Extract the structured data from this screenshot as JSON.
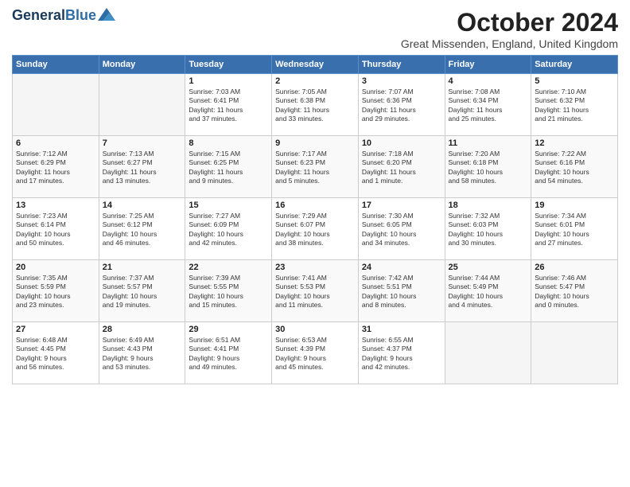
{
  "logo": {
    "line1": "General",
    "line2": "Blue"
  },
  "header": {
    "title": "October 2024",
    "location": "Great Missenden, England, United Kingdom"
  },
  "weekdays": [
    "Sunday",
    "Monday",
    "Tuesday",
    "Wednesday",
    "Thursday",
    "Friday",
    "Saturday"
  ],
  "weeks": [
    [
      {
        "day": "",
        "data": ""
      },
      {
        "day": "",
        "data": ""
      },
      {
        "day": "1",
        "data": "Sunrise: 7:03 AM\nSunset: 6:41 PM\nDaylight: 11 hours\nand 37 minutes."
      },
      {
        "day": "2",
        "data": "Sunrise: 7:05 AM\nSunset: 6:38 PM\nDaylight: 11 hours\nand 33 minutes."
      },
      {
        "day": "3",
        "data": "Sunrise: 7:07 AM\nSunset: 6:36 PM\nDaylight: 11 hours\nand 29 minutes."
      },
      {
        "day": "4",
        "data": "Sunrise: 7:08 AM\nSunset: 6:34 PM\nDaylight: 11 hours\nand 25 minutes."
      },
      {
        "day": "5",
        "data": "Sunrise: 7:10 AM\nSunset: 6:32 PM\nDaylight: 11 hours\nand 21 minutes."
      }
    ],
    [
      {
        "day": "6",
        "data": "Sunrise: 7:12 AM\nSunset: 6:29 PM\nDaylight: 11 hours\nand 17 minutes."
      },
      {
        "day": "7",
        "data": "Sunrise: 7:13 AM\nSunset: 6:27 PM\nDaylight: 11 hours\nand 13 minutes."
      },
      {
        "day": "8",
        "data": "Sunrise: 7:15 AM\nSunset: 6:25 PM\nDaylight: 11 hours\nand 9 minutes."
      },
      {
        "day": "9",
        "data": "Sunrise: 7:17 AM\nSunset: 6:23 PM\nDaylight: 11 hours\nand 5 minutes."
      },
      {
        "day": "10",
        "data": "Sunrise: 7:18 AM\nSunset: 6:20 PM\nDaylight: 11 hours\nand 1 minute."
      },
      {
        "day": "11",
        "data": "Sunrise: 7:20 AM\nSunset: 6:18 PM\nDaylight: 10 hours\nand 58 minutes."
      },
      {
        "day": "12",
        "data": "Sunrise: 7:22 AM\nSunset: 6:16 PM\nDaylight: 10 hours\nand 54 minutes."
      }
    ],
    [
      {
        "day": "13",
        "data": "Sunrise: 7:23 AM\nSunset: 6:14 PM\nDaylight: 10 hours\nand 50 minutes."
      },
      {
        "day": "14",
        "data": "Sunrise: 7:25 AM\nSunset: 6:12 PM\nDaylight: 10 hours\nand 46 minutes."
      },
      {
        "day": "15",
        "data": "Sunrise: 7:27 AM\nSunset: 6:09 PM\nDaylight: 10 hours\nand 42 minutes."
      },
      {
        "day": "16",
        "data": "Sunrise: 7:29 AM\nSunset: 6:07 PM\nDaylight: 10 hours\nand 38 minutes."
      },
      {
        "day": "17",
        "data": "Sunrise: 7:30 AM\nSunset: 6:05 PM\nDaylight: 10 hours\nand 34 minutes."
      },
      {
        "day": "18",
        "data": "Sunrise: 7:32 AM\nSunset: 6:03 PM\nDaylight: 10 hours\nand 30 minutes."
      },
      {
        "day": "19",
        "data": "Sunrise: 7:34 AM\nSunset: 6:01 PM\nDaylight: 10 hours\nand 27 minutes."
      }
    ],
    [
      {
        "day": "20",
        "data": "Sunrise: 7:35 AM\nSunset: 5:59 PM\nDaylight: 10 hours\nand 23 minutes."
      },
      {
        "day": "21",
        "data": "Sunrise: 7:37 AM\nSunset: 5:57 PM\nDaylight: 10 hours\nand 19 minutes."
      },
      {
        "day": "22",
        "data": "Sunrise: 7:39 AM\nSunset: 5:55 PM\nDaylight: 10 hours\nand 15 minutes."
      },
      {
        "day": "23",
        "data": "Sunrise: 7:41 AM\nSunset: 5:53 PM\nDaylight: 10 hours\nand 11 minutes."
      },
      {
        "day": "24",
        "data": "Sunrise: 7:42 AM\nSunset: 5:51 PM\nDaylight: 10 hours\nand 8 minutes."
      },
      {
        "day": "25",
        "data": "Sunrise: 7:44 AM\nSunset: 5:49 PM\nDaylight: 10 hours\nand 4 minutes."
      },
      {
        "day": "26",
        "data": "Sunrise: 7:46 AM\nSunset: 5:47 PM\nDaylight: 10 hours\nand 0 minutes."
      }
    ],
    [
      {
        "day": "27",
        "data": "Sunrise: 6:48 AM\nSunset: 4:45 PM\nDaylight: 9 hours\nand 56 minutes."
      },
      {
        "day": "28",
        "data": "Sunrise: 6:49 AM\nSunset: 4:43 PM\nDaylight: 9 hours\nand 53 minutes."
      },
      {
        "day": "29",
        "data": "Sunrise: 6:51 AM\nSunset: 4:41 PM\nDaylight: 9 hours\nand 49 minutes."
      },
      {
        "day": "30",
        "data": "Sunrise: 6:53 AM\nSunset: 4:39 PM\nDaylight: 9 hours\nand 45 minutes."
      },
      {
        "day": "31",
        "data": "Sunrise: 6:55 AM\nSunset: 4:37 PM\nDaylight: 9 hours\nand 42 minutes."
      },
      {
        "day": "",
        "data": ""
      },
      {
        "day": "",
        "data": ""
      }
    ]
  ]
}
